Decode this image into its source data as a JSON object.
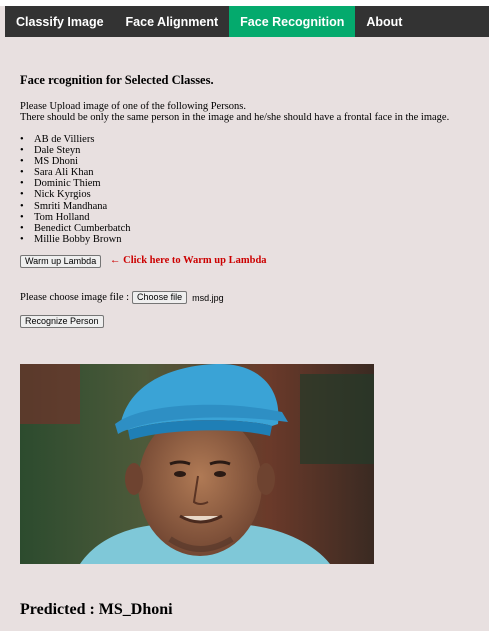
{
  "nav": {
    "items": [
      {
        "label": "Classify Image",
        "active": false
      },
      {
        "label": "Face Alignment",
        "active": false
      },
      {
        "label": "Face Recognition",
        "active": true
      },
      {
        "label": "About",
        "active": false
      }
    ],
    "active_color": "#04aa6d",
    "bar_color": "#333333"
  },
  "page": {
    "heading": "Face rcognition for Selected Classes.",
    "intro_line1": "Please Upload image of one of the following Persons.",
    "intro_line2": "There should be only the same person in the image and he/she should have a frontal face in the image.",
    "persons": [
      "AB de Villiers",
      "Dale Steyn",
      "MS Dhoni",
      "Sara Ali Khan",
      "Dominic Thiem",
      "Nick Kyrgios",
      "Smriti Mandhana",
      "Tom Holland",
      "Benedict Cumberbatch",
      "Millie Bobby Brown"
    ],
    "warm_button": "Warm up Lambda",
    "warm_note": "← Click here to Warm up Lambda",
    "choose_label": "Please choose image file :",
    "choose_button": "Choose file",
    "file_name": "msd.jpg",
    "recognize_button": "Recognize Person",
    "predicted": "Predicted : MS_Dhoni",
    "note_color": "#cc0000",
    "background_color": "#e8e0e0"
  }
}
